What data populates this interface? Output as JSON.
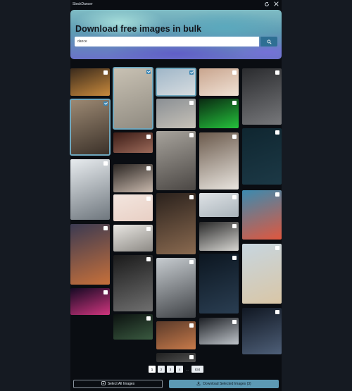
{
  "header": {
    "brand": "StockDancer",
    "icons": [
      "refresh-icon",
      "x-logo-icon"
    ]
  },
  "hero": {
    "title": "Download free images in bulk",
    "search_value": "dance",
    "search_icon": "search-icon"
  },
  "gallery": {
    "images": [
      {
        "name": "fire-dancer",
        "selected": false
      },
      {
        "name": "ballerina-courtyard",
        "selected": true
      },
      {
        "name": "bridge-dancer",
        "selected": true
      },
      {
        "name": "couple-embrace",
        "selected": false
      },
      {
        "name": "ballet-feet",
        "selected": false
      },
      {
        "name": "beach-dancer",
        "selected": true
      },
      {
        "name": "street-dancers",
        "selected": false
      },
      {
        "name": "green-light-stage",
        "selected": false
      },
      {
        "name": "couple-red-wall",
        "selected": false
      },
      {
        "name": "bride-street",
        "selected": false
      },
      {
        "name": "dancer-rooftop",
        "selected": false
      },
      {
        "name": "skirt-on-hanger",
        "selected": false
      },
      {
        "name": "dancer-cloudy-sky",
        "selected": false
      },
      {
        "name": "couple-dark",
        "selected": false
      },
      {
        "name": "pastel-dancer",
        "selected": false
      },
      {
        "name": "ballet-hall",
        "selected": false
      },
      {
        "name": "dancer-white-field",
        "selected": false
      },
      {
        "name": "carousel-lights",
        "selected": false
      },
      {
        "name": "street-jump",
        "selected": false
      },
      {
        "name": "sunset-silhouette",
        "selected": false
      },
      {
        "name": "studio-dancer",
        "selected": false
      },
      {
        "name": "woman-wheat-field",
        "selected": false
      },
      {
        "name": "hands-reaching",
        "selected": false
      },
      {
        "name": "arch-window-dancer",
        "selected": false
      },
      {
        "name": "balloon-dancer",
        "selected": false
      },
      {
        "name": "neon-party",
        "selected": false
      },
      {
        "name": "dark-room-dancer",
        "selected": false
      },
      {
        "name": "concert-lights",
        "selected": false
      },
      {
        "name": "warm-room-dancer",
        "selected": false
      },
      {
        "name": "bridge-beams-dancer",
        "selected": false
      },
      {
        "name": "dark-hall-dancer",
        "selected": false
      }
    ]
  },
  "pagination": {
    "pages": [
      "1",
      "2",
      "3",
      "4"
    ],
    "ellipsis": "...",
    "last": "834",
    "current": "1"
  },
  "actions": {
    "select_all": "Select All Images",
    "select_all_icon": "select-all-icon",
    "download": "Download Selected Images (3)",
    "download_icon": "download-icon"
  },
  "colors": {
    "page_bg": "#151a22",
    "app_bg": "#0a0d12",
    "accent": "#5c99b4",
    "selection": "#6fa7bd"
  }
}
